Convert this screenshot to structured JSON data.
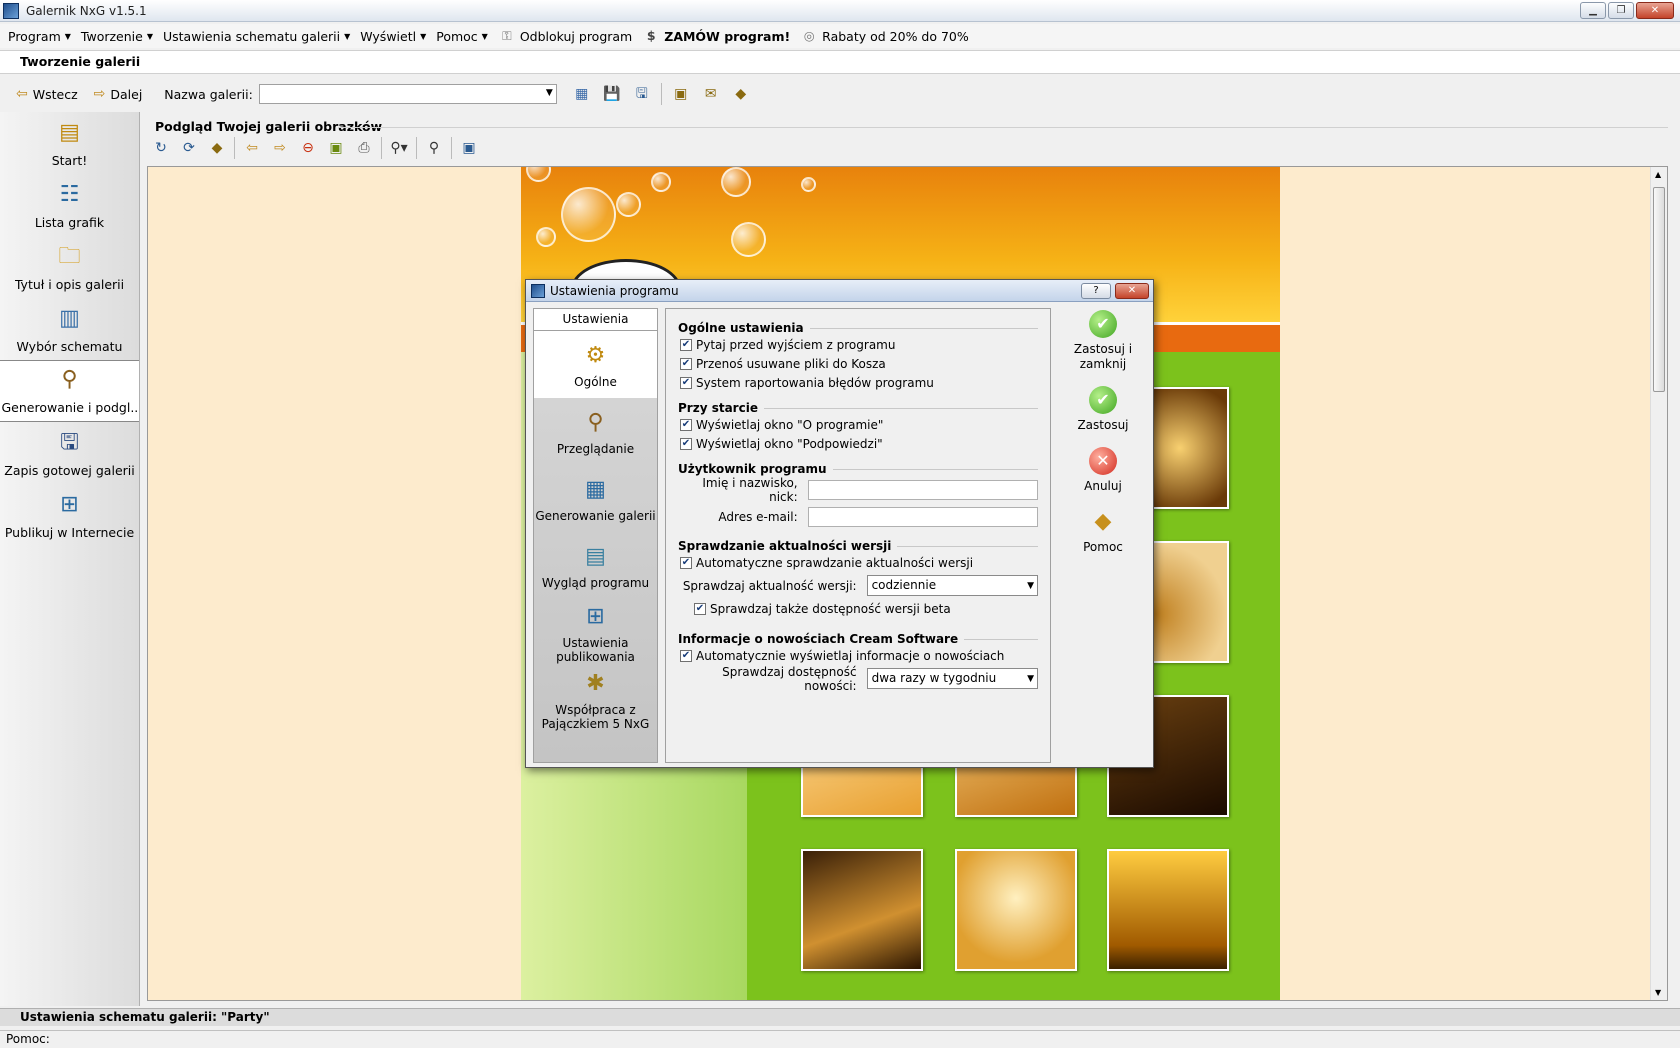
{
  "window": {
    "title": "Galernik NxG v1.5.1"
  },
  "menu": [
    {
      "label": "Program",
      "dropdown": true
    },
    {
      "label": "Tworzenie",
      "dropdown": true
    },
    {
      "label": "Ustawienia schematu galerii",
      "dropdown": true
    },
    {
      "label": "Wyświetl",
      "dropdown": true
    },
    {
      "label": "Pomoc",
      "dropdown": true
    },
    {
      "label": "Odblokuj program",
      "icon": "key-icon"
    },
    {
      "label": "ZAMÓW program!",
      "icon": "dollar-icon",
      "bold": true
    },
    {
      "label": "Rabaty od 20% do 70%",
      "icon": "discount-icon"
    }
  ],
  "section": {
    "title": "Tworzenie galerii"
  },
  "nav": {
    "back_label": "Wstecz",
    "next_label": "Dalej",
    "gallery_name_label": "Nazwa galerii:",
    "gallery_name_value": ""
  },
  "sidebar": {
    "items": [
      {
        "label": "Start!",
        "icon": "start-icon"
      },
      {
        "label": "Lista grafik",
        "icon": "image-list-icon"
      },
      {
        "label": "Tytuł i opis galerii",
        "icon": "folder-description-icon"
      },
      {
        "label": "Wybór schematu",
        "icon": "template-icon"
      },
      {
        "label": "Generowanie i podgl...",
        "icon": "magnifier-icon",
        "active": true
      },
      {
        "label": "Zapis gotowej galerii",
        "icon": "floppy-icon"
      },
      {
        "label": "Publikuj w Internecie",
        "icon": "publish-icon"
      }
    ]
  },
  "preview": {
    "title": "Podgląd Twojej galerii obrazków"
  },
  "dialog": {
    "title": "Ustawienia programu",
    "help_btn": "?",
    "close_btn": "✕",
    "tabs_header": "Ustawienia",
    "tabs": [
      {
        "label": "Ogólne",
        "icon": "gear-icon",
        "active": true
      },
      {
        "label": "Przeglądanie",
        "icon": "magnifier-icon"
      },
      {
        "label": "Generowanie galerii",
        "icon": "generate-icon"
      },
      {
        "label": "Wygląd programu",
        "icon": "appearance-icon"
      },
      {
        "label": "Ustawienia publikowania",
        "icon": "publish-settings-icon"
      },
      {
        "label": "Współpraca z Pajączkiem 5 NxG",
        "icon": "spider-icon"
      }
    ],
    "groups": {
      "general": {
        "title": "Ogólne ustawienia",
        "options": [
          {
            "label": "Pytaj przed wyjściem z programu",
            "checked": true
          },
          {
            "label": "Przenoś usuwane pliki do Kosza",
            "checked": true
          },
          {
            "label": "System raportowania błędów programu",
            "checked": true
          }
        ]
      },
      "startup": {
        "title": "Przy starcie",
        "options": [
          {
            "label": "Wyświetlaj okno \"O programie\"",
            "checked": true
          },
          {
            "label": "Wyświetlaj okno \"Podpowiedzi\"",
            "checked": true
          }
        ]
      },
      "user": {
        "title": "Użytkownik programu",
        "name_label": "Imię i nazwisko, nick:",
        "name_value": "",
        "email_label": "Adres e-mail:",
        "email_value": ""
      },
      "updates": {
        "title": "Sprawdzanie aktualności wersji",
        "auto_label": "Automatyczne sprawdzanie aktualności wersji",
        "auto_checked": true,
        "freq_label": "Sprawdzaj aktualność wersji:",
        "freq_value": "codziennie",
        "beta_label": "Sprawdzaj także dostępność wersji beta",
        "beta_checked": true
      },
      "news": {
        "title": "Informacje o nowościach Cream Software",
        "auto_label": "Automatycznie wyświetlaj informacje o nowościach",
        "auto_checked": true,
        "freq_label": "Sprawdzaj dostępność nowości:",
        "freq_value": "dwa razy w tygodniu"
      }
    },
    "actions": {
      "apply_close": "Zastosuj i zamknij",
      "apply": "Zastosuj",
      "cancel": "Anuluj",
      "help": "Pomoc"
    }
  },
  "status": {
    "scheme": "Ustawienia schematu galerii: \"Party\"",
    "help": "Pomoc:"
  },
  "colors": {
    "accent_orange": "#e86a10",
    "gallery_green": "#7cc21c"
  }
}
